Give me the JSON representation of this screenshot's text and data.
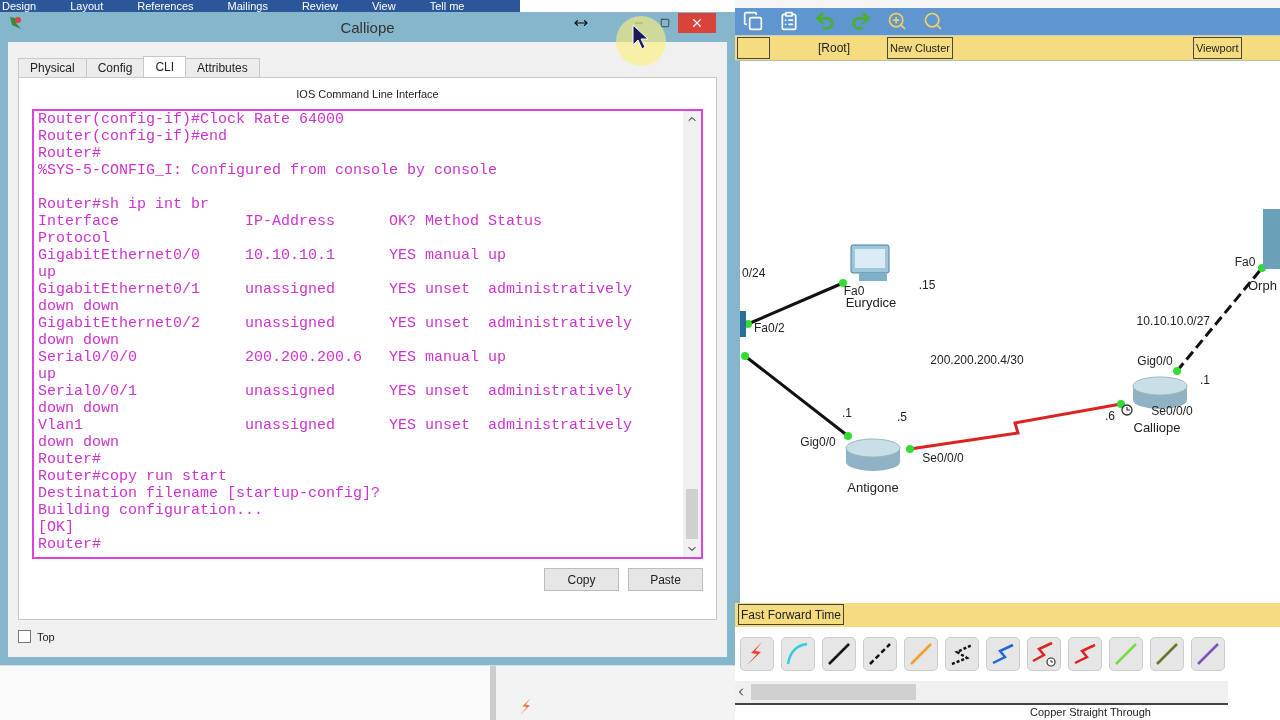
{
  "word_ribbon": {
    "tabs": [
      "Design",
      "Layout",
      "References",
      "Mailings",
      "Review",
      "View",
      "Tell me"
    ]
  },
  "dialog": {
    "title": "Calliope",
    "tabs": [
      {
        "label": "Physical",
        "selected": false
      },
      {
        "label": "Config",
        "selected": false
      },
      {
        "label": "CLI",
        "selected": true
      },
      {
        "label": "Attributes",
        "selected": false
      }
    ],
    "panel_title": "IOS Command Line Interface",
    "console_blocks": [
      [
        "Router(config-if)#Clock Rate 64000",
        "Router(config-if)#end",
        "Router#",
        "%SYS-5-CONFIG_I: Configured from console by console"
      ],
      [
        "Router#sh ip int br",
        "Interface              IP-Address      OK? Method Status",
        "Protocol",
        "GigabitEthernet0/0     10.10.10.1      YES manual up",
        "up",
        "GigabitEthernet0/1     unassigned      YES unset  administratively",
        "down down",
        "GigabitEthernet0/2     unassigned      YES unset  administratively",
        "down down",
        "Serial0/0/0            200.200.200.6   YES manual up",
        "up",
        "Serial0/0/1            unassigned      YES unset  administratively",
        "down down",
        "Vlan1                  unassigned      YES unset  administratively",
        "down down",
        "Router#",
        "Router#copy run start",
        "Destination filename [startup-config]?",
        "Building configuration...",
        "[OK]",
        "Router#"
      ]
    ],
    "buttons": [
      "Copy",
      "Paste"
    ],
    "top_checkbox": {
      "label": "Top",
      "checked": false
    }
  },
  "workspace": {
    "nav_bar": {
      "root": "[Root]",
      "buttons": [
        "New Cluster",
        "Viewport"
      ]
    },
    "diagram": {
      "devices": [
        {
          "kind": "switch"
        },
        {
          "kind": "pc",
          "name": "Eurydice"
        },
        {
          "kind": "router",
          "name": "Antigone"
        },
        {
          "kind": "router",
          "name": "Calliope"
        },
        {
          "kind": "server",
          "name": "Orph"
        }
      ],
      "links": [
        {
          "kind": "straight"
        },
        {
          "kind": "straight"
        },
        {
          "kind": "serial",
          "clock": true
        },
        {
          "kind": "cross"
        }
      ],
      "labels": [
        "0/24",
        "Fa0/2",
        "Fa0",
        ".15",
        "200.200.200.4/30",
        ".1",
        ".5",
        "Gig0/0",
        "Se0/0/0",
        "Gig0/0",
        ".1",
        ".6",
        "Se0/0/0",
        "10.10.10.0/27",
        "Fa0"
      ]
    },
    "realtime_bar": {
      "button": "Fast Forward Time"
    },
    "cables": [
      {
        "kind": "auto",
        "color": "#e8402a"
      },
      {
        "kind": "console",
        "color": "#33ccdd"
      },
      {
        "kind": "straight",
        "color": "#111111"
      },
      {
        "kind": "cross",
        "color": "#111111"
      },
      {
        "kind": "fiber",
        "color": "#f0a030"
      },
      {
        "kind": "phone",
        "color": "#111111"
      },
      {
        "kind": "coax",
        "color": "#2266dd"
      },
      {
        "kind": "serial-dce",
        "color": "#dd2222"
      },
      {
        "kind": "serial-dte",
        "color": "#dd2222"
      },
      {
        "kind": "octal",
        "color": "#77dd44"
      },
      {
        "kind": "iot",
        "color": "#667722"
      },
      {
        "kind": "usb",
        "color": "#7755bb"
      }
    ],
    "caption": "Copper Straight Through"
  }
}
